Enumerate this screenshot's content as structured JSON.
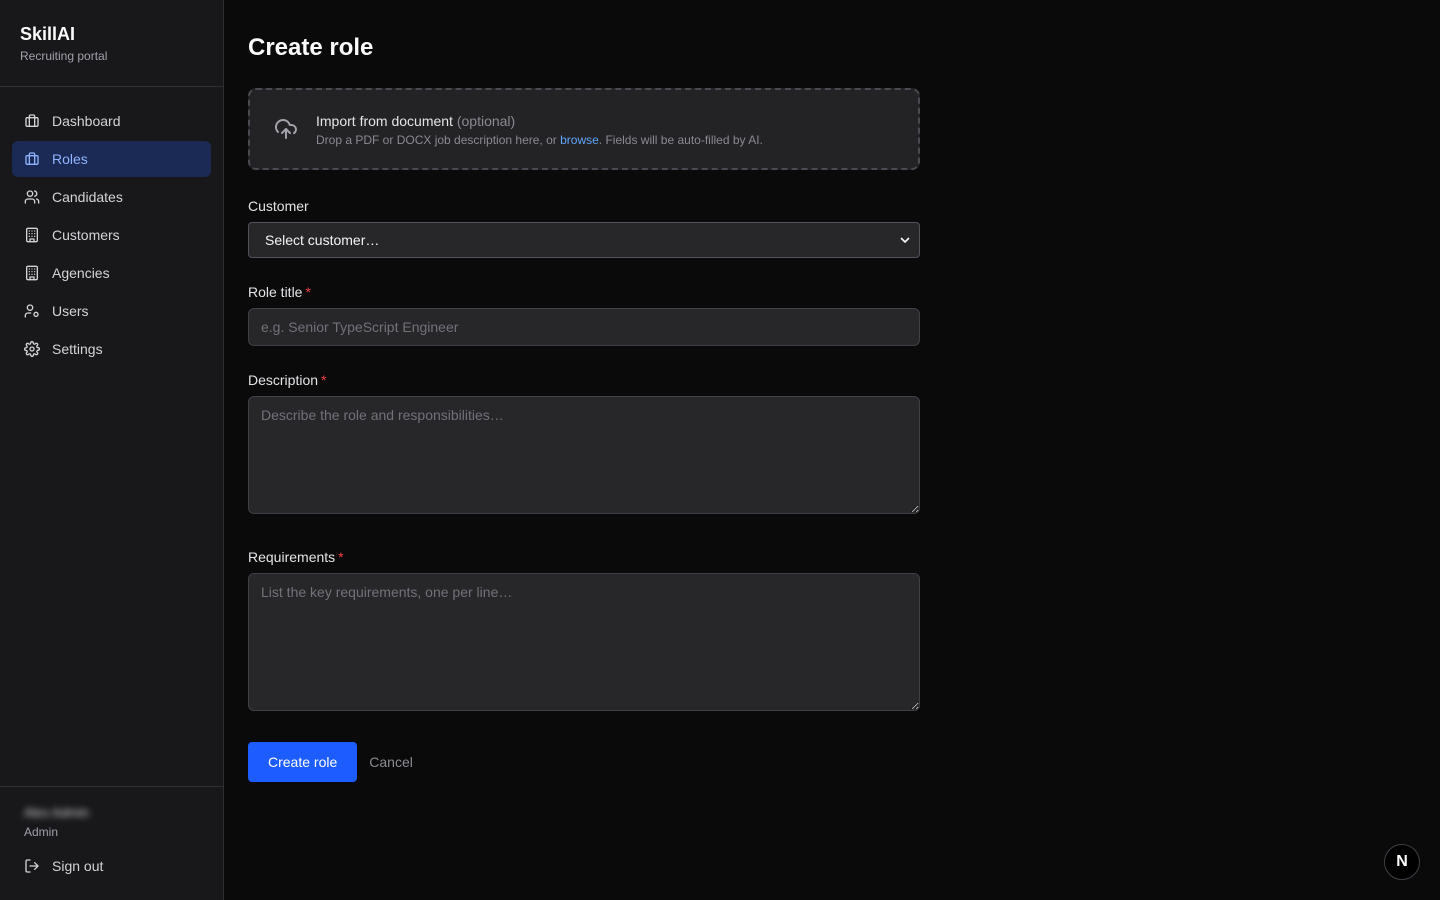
{
  "brand": {
    "name": "SkillAI",
    "subtitle": "Recruiting portal"
  },
  "sidebar": {
    "items": [
      {
        "label": "Dashboard",
        "icon": "briefcase-icon",
        "active": false
      },
      {
        "label": "Roles",
        "icon": "briefcase-icon",
        "active": true
      },
      {
        "label": "Candidates",
        "icon": "users-icon",
        "active": false
      },
      {
        "label": "Customers",
        "icon": "building-icon",
        "active": false
      },
      {
        "label": "Agencies",
        "icon": "building-icon",
        "active": false
      },
      {
        "label": "Users",
        "icon": "user-cog-icon",
        "active": false
      },
      {
        "label": "Settings",
        "icon": "gear-icon",
        "active": false
      }
    ],
    "user": {
      "name": "Alex Admin",
      "role": "Admin"
    },
    "signout_label": "Sign out"
  },
  "main": {
    "title": "Create role",
    "import": {
      "title": "Import from document",
      "optional": "(optional)",
      "sub_before": "Drop a PDF or DOCX job description here, or ",
      "sub_link": "browse",
      "sub_after": ". Fields will be auto-filled by AI."
    },
    "customer": {
      "label": "Customer",
      "value": "Select customer…"
    },
    "role_title": {
      "label": "Role title",
      "required": "*",
      "placeholder": "e.g. Senior TypeScript Engineer"
    },
    "description": {
      "label": "Description",
      "required": "*",
      "placeholder": "Describe the role and responsibilities…"
    },
    "requirements": {
      "label": "Requirements",
      "required": "*",
      "placeholder": "List the key requirements, one per line…"
    },
    "submit_label": "Create role",
    "cancel_label": "Cancel"
  },
  "badge": {
    "letter": "N"
  },
  "colors": {
    "accent": "#1d5cff",
    "active_nav_bg": "#1b2a55",
    "active_nav_text": "#8fb4ff",
    "link": "#60a5fa",
    "required": "#ef4444"
  }
}
